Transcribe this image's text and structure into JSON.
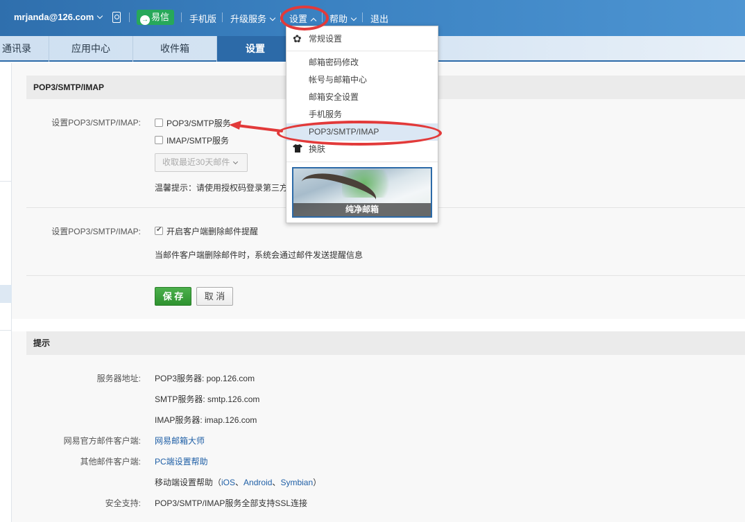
{
  "header": {
    "user_email": "mrjanda@126.com",
    "yixin_label": "易信",
    "mobile_label": "手机版",
    "upgrade_label": "升级服务",
    "settings_label": "设置",
    "help_label": "帮助",
    "logout_label": "退出"
  },
  "tabs": [
    {
      "label": "通讯录"
    },
    {
      "label": "应用中心"
    },
    {
      "label": "收件箱"
    },
    {
      "label": "设置"
    }
  ],
  "dropdown": {
    "general_label": "常规设置",
    "items": [
      {
        "label": "邮箱密码修改"
      },
      {
        "label": "帐号与邮箱中心"
      },
      {
        "label": "邮箱安全设置"
      },
      {
        "label": "手机服务"
      },
      {
        "label": "POP3/SMTP/IMAP"
      }
    ],
    "skin_label": "换肤",
    "skin_theme_name": "纯净邮箱"
  },
  "pop_section": {
    "title": "POP3/SMTP/IMAP",
    "row1_label": "设置POP3/SMTP/IMAP:",
    "pop3_smtp_label": "POP3/SMTP服务",
    "imap_smtp_label": "IMAP/SMTP服务",
    "receive_select": "收取最近30天邮件",
    "tip": "温馨提示：请使用授权码登录第三方",
    "row2_label": "设置POP3/SMTP/IMAP:",
    "delete_alert_label": "开启客户端删除邮件提醒",
    "delete_alert_desc": "当邮件客户端删除邮件时，系统会通过邮件发送提醒信息",
    "save_label": "保 存",
    "cancel_label": "取 消"
  },
  "tips_section": {
    "title": "提示",
    "server_label": "服务器地址:",
    "pop3_server": "POP3服务器: pop.126.com",
    "smtp_server": "SMTP服务器: smtp.126.com",
    "imap_server": "IMAP服务器: imap.126.com",
    "official_client_label": "网易官方邮件客户端:",
    "official_client_link": "网易邮箱大师",
    "other_client_label": "其他邮件客户端:",
    "pc_help_link": "PC端设置帮助",
    "mobile_help_prefix": "移动端设置帮助（",
    "ios": "iOS",
    "sep1": "、",
    "android": "Android",
    "sep2": "、",
    "symbian": "Symbian",
    "mobile_help_suffix": "）",
    "security_label": "安全支持:",
    "security_text": "POP3/SMTP/IMAP服务全部支持SSL连接"
  },
  "colors": {
    "header_blue": "#3b82c2",
    "active_tab": "#2c6aa8",
    "yixin_green": "#27a85a",
    "save_green": "#3aa03a",
    "annotation_red": "#e23a3a",
    "link_blue": "#1f5fa6"
  }
}
